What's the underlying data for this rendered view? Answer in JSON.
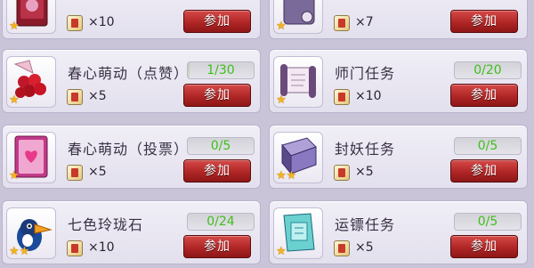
{
  "colors": {
    "progress_text": "#3fbf1a",
    "button": "#b02626",
    "star": "#f4b21c"
  },
  "activities": [
    {
      "title": "",
      "icon": "red-book-icon",
      "stars": 1,
      "reward_count": "×10",
      "progress": "",
      "progress_fraction": 0,
      "button_label": "参加"
    },
    {
      "title": "",
      "icon": "purple-bag-icon",
      "stars": 1,
      "reward_count": "×7",
      "progress": "",
      "progress_fraction": 0,
      "button_label": "参加"
    },
    {
      "title": "春心萌动（点赞）",
      "icon": "rose-bouquet-icon",
      "stars": 1,
      "reward_count": "×5",
      "progress": "1/30",
      "progress_fraction": 0.033,
      "button_label": "参加"
    },
    {
      "title": "师门任务",
      "icon": "scroll-icon",
      "stars": 1,
      "reward_count": "×10",
      "progress": "0/20",
      "progress_fraction": 0,
      "button_label": "参加"
    },
    {
      "title": "春心萌动（投票）",
      "icon": "heart-card-icon",
      "stars": 1,
      "reward_count": "×5",
      "progress": "0/5",
      "progress_fraction": 0,
      "button_label": "参加"
    },
    {
      "title": "封妖任务",
      "icon": "purple-tome-icon",
      "stars": 2,
      "reward_count": "×5",
      "progress": "0/5",
      "progress_fraction": 0,
      "button_label": "参加"
    },
    {
      "title": "七色玲珑石",
      "icon": "toucan-icon",
      "stars": 2,
      "reward_count": "×10",
      "progress": "0/24",
      "progress_fraction": 0,
      "button_label": "参加"
    },
    {
      "title": "运镖任务",
      "icon": "cyan-book-icon",
      "stars": 1,
      "reward_count": "×5",
      "progress": "0/5",
      "progress_fraction": 0,
      "button_label": "参加"
    }
  ]
}
